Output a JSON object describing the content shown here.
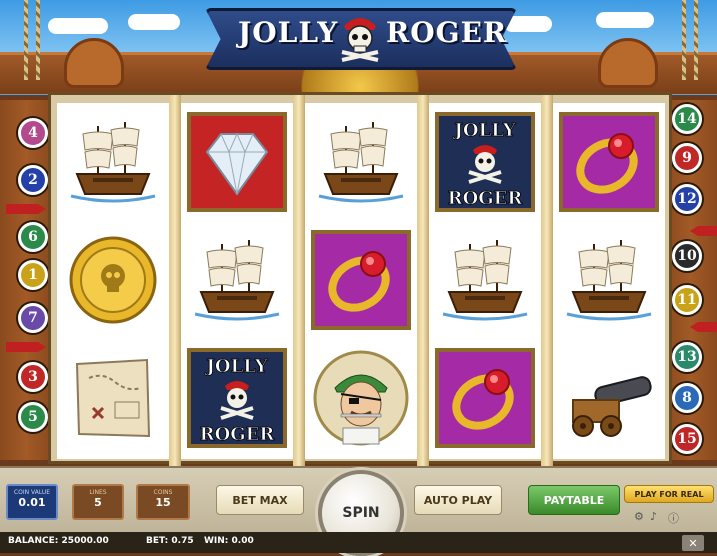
{
  "game": {
    "logo_word1": "JOLLY",
    "logo_word2": "ROGER"
  },
  "paylines": {
    "left": [
      "4",
      "2",
      "6",
      "1",
      "7",
      "3",
      "5"
    ],
    "right": [
      "14",
      "9",
      "12",
      "10",
      "11",
      "13",
      "8",
      "15"
    ],
    "left_colors": [
      "#b34a8e",
      "#2341a8",
      "#2a8a4a",
      "#c9a21a",
      "#6a4aa8",
      "#c02828",
      "#2a8a4a"
    ],
    "right_colors": [
      "#2a8a4a",
      "#c02828",
      "#2341a8",
      "#2a2a2a",
      "#c9a21a",
      "#2a8a6a",
      "#2a6ab8",
      "#c02828"
    ]
  },
  "reels": [
    [
      "ship-icon",
      "coin-icon",
      "map-icon"
    ],
    [
      "diamond-icon",
      "ship-icon",
      "jolly-roger-icon"
    ],
    [
      "ship-icon",
      "ring-icon",
      "pirate-icon"
    ],
    [
      "jolly-roger-icon",
      "ship-icon",
      "ring-icon"
    ],
    [
      "ring-icon",
      "ship-icon",
      "cannon-icon"
    ]
  ],
  "jolly_roger_text": [
    "JOLLY",
    "ROGER"
  ],
  "controls": {
    "coin_value_label": "COIN VALUE",
    "coin_value": "0.01",
    "lines_label": "LINES",
    "lines": "5",
    "coins_label": "COINS",
    "coins": "15",
    "bet_max": "BET MAX",
    "spin": "SPIN",
    "auto_play": "AUTO PLAY",
    "paytable": "PAYTABLE",
    "play_for_real": "PLAY FOR REAL"
  },
  "status": {
    "balance": "BALANCE: 25000.00",
    "bet": "BET: 0.75",
    "win": "WIN: 0.00",
    "close": "✕"
  },
  "colors": {
    "banner": "#2f4c8a",
    "paytable_green": "#4a9a3a",
    "play_real_gold": "#f0c030"
  }
}
